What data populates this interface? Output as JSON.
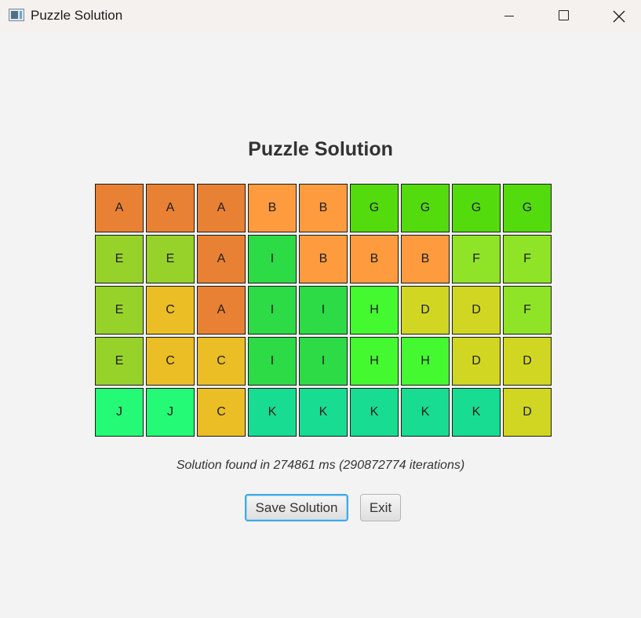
{
  "window": {
    "title": "Puzzle Solution"
  },
  "main": {
    "heading": "Puzzle Solution",
    "status": "Solution found in 274861 ms (290872774 iterations)"
  },
  "buttons": {
    "save_label": "Save Solution",
    "exit_label": "Exit"
  },
  "piece_colors": {
    "A": "#e98134",
    "B": "#fd9b3e",
    "C": "#ecbe25",
    "D": "#d1d622",
    "E": "#97d22b",
    "F": "#8fe427",
    "G": "#54db0e",
    "H": "#44f92f",
    "I": "#2cdb45",
    "J": "#25fa76",
    "K": "#17dc92"
  },
  "grid": [
    [
      "A",
      "A",
      "A",
      "B",
      "B",
      "G",
      "G",
      "G",
      "G"
    ],
    [
      "E",
      "E",
      "A",
      "I",
      "B",
      "B",
      "B",
      "F",
      "F"
    ],
    [
      "E",
      "C",
      "A",
      "I",
      "I",
      "H",
      "D",
      "D",
      "F"
    ],
    [
      "E",
      "C",
      "C",
      "I",
      "I",
      "H",
      "H",
      "D",
      "D"
    ],
    [
      "J",
      "J",
      "C",
      "K",
      "K",
      "K",
      "K",
      "K",
      "D"
    ]
  ]
}
